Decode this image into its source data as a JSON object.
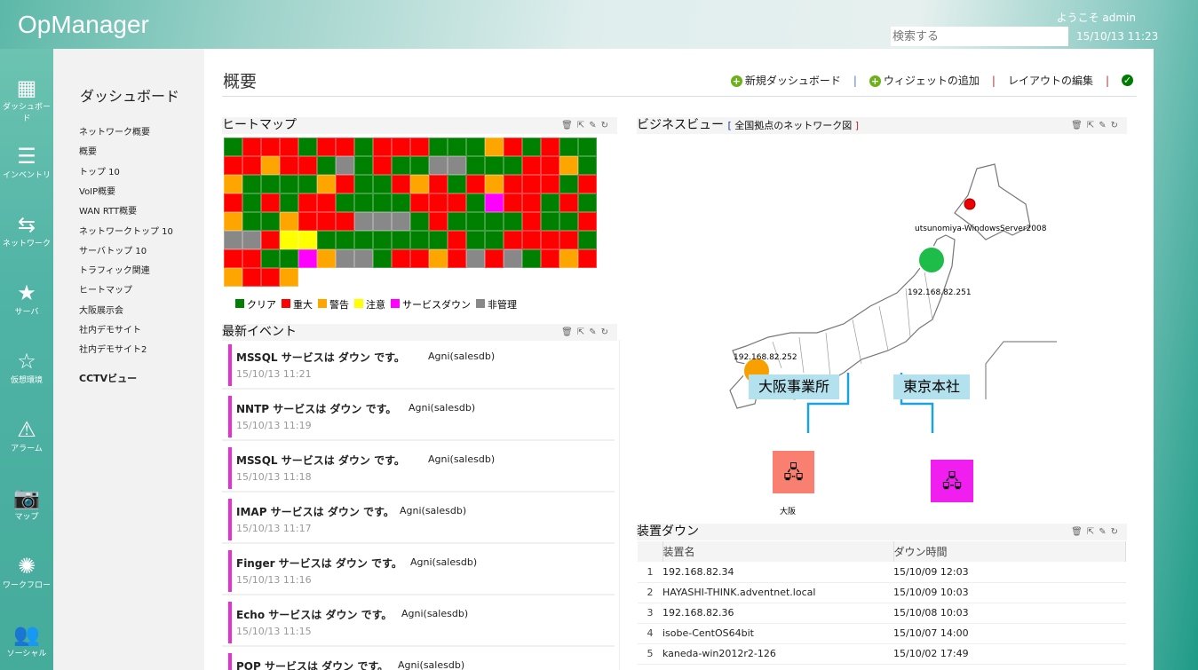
{
  "app": {
    "title": "OpManager",
    "welcome": "ようこそ admin",
    "search_placeholder": "検索する",
    "clock": "15/10/13 11:23"
  },
  "rail": [
    {
      "label": "ダッシュボード",
      "icon": "dashboard-icon"
    },
    {
      "label": "インベントリ",
      "icon": "list-icon"
    },
    {
      "label": "ネットワーク",
      "icon": "arrows-icon"
    },
    {
      "label": "サーバ",
      "icon": "star-icon"
    },
    {
      "label": "仮想環境",
      "icon": "star-outline-icon"
    },
    {
      "label": "アラーム",
      "icon": "warning-icon"
    },
    {
      "label": "マップ",
      "icon": "camera-icon"
    },
    {
      "label": "ワークフロー",
      "icon": "spinner-icon"
    },
    {
      "label": "ソーシャル",
      "icon": "users-icon"
    }
  ],
  "submenu": {
    "title": "ダッシュボード",
    "items": [
      "ネットワーク概要",
      "概要",
      "トップ 10",
      "VoIP概要",
      "WAN RTT概要",
      "ネットワークトップ 10",
      "サーバトップ 10",
      "トラフィック関連",
      "ヒートマップ",
      "大阪展示会",
      "社内デモサイト",
      "社内デモサイト2"
    ],
    "cctv": "CCTVビュー"
  },
  "page": {
    "title": "概要",
    "new_dashboard": "新規ダッシュボード",
    "add_widget": "ウィジェットの追加",
    "edit_layout": "レイアウトの編集"
  },
  "heatmap": {
    "title": "ヒートマップ",
    "colors": {
      "G": "#008000",
      "R": "#ff0000",
      "O": "#ffa500",
      "Y": "#ffff00",
      "M": "#ff00ff",
      "X": "#888888"
    },
    "rows": [
      "GRRRGRRGRRRGGGORGRGG",
      "RRORRGXGRGGXXGGGRROG",
      "OGGGGORGGRORGRORRRGR",
      "RGRGRRGGGGRRRGMRRGRG",
      "OGGORRRXXXGRGGGGRGGR",
      "XXRYYGGGGGGGRGGRRRRG",
      "RRGGMOXXGRRORXRXGROR",
      "ORRO"
    ],
    "legend": [
      {
        "key": "G",
        "label": "クリア"
      },
      {
        "key": "R",
        "label": "重大"
      },
      {
        "key": "O",
        "label": "警告"
      },
      {
        "key": "Y",
        "label": "注意"
      },
      {
        "key": "M",
        "label": "サービスダウン"
      },
      {
        "key": "X",
        "label": "非管理"
      }
    ]
  },
  "events": {
    "title": "最新イベント",
    "items": [
      {
        "msg": "MSSQL サービスは ダウン です。",
        "src": "Agni(salesdb)",
        "time": "15/10/13 11:21"
      },
      {
        "msg": "NNTP サービスは ダウン です。",
        "src": "Agni(salesdb)",
        "time": "15/10/13 11:19"
      },
      {
        "msg": "MSSQL サービスは ダウン です。",
        "src": "Agni(salesdb)",
        "time": "15/10/13 11:18"
      },
      {
        "msg": "IMAP サービスは ダウン です。",
        "src": "Agni(salesdb)",
        "time": "15/10/13 11:17"
      },
      {
        "msg": "Finger サービスは ダウン です。",
        "src": "Agni(salesdb)",
        "time": "15/10/13 11:16"
      },
      {
        "msg": "Echo サービスは ダウン です。",
        "src": "Agni(salesdb)",
        "time": "15/10/13 11:15"
      },
      {
        "msg": "POP サービスは ダウン です。",
        "src": "Agni(salesdb)",
        "time": ""
      }
    ]
  },
  "business": {
    "title": "ビジネスビュー",
    "subtitle": "全国拠点のネットワーク図",
    "node_north": "utsunomiya-WindowsServer2008",
    "node_green": "192.168.82.251",
    "node_orange": "192.168.82.252",
    "label_osaka": "大阪事業所",
    "label_tokyo": "東京本社",
    "group_osaka": "大阪"
  },
  "devices": {
    "title": "装置ダウン",
    "headers": [
      "装置名",
      "ダウン時間"
    ],
    "rows": [
      {
        "n": "1",
        "name": "192.168.82.34",
        "time": "15/10/09 12:03"
      },
      {
        "n": "2",
        "name": "HAYASHI-THINK.adventnet.local",
        "time": "15/10/09 10:03"
      },
      {
        "n": "3",
        "name": "192.168.82.36",
        "time": "15/10/08 10:03"
      },
      {
        "n": "4",
        "name": "isobe-CentOS64bit",
        "time": "15/10/07 14:00"
      },
      {
        "n": "5",
        "name": "kaneda-win2012r2-126",
        "time": "15/10/02 17:49"
      }
    ]
  }
}
